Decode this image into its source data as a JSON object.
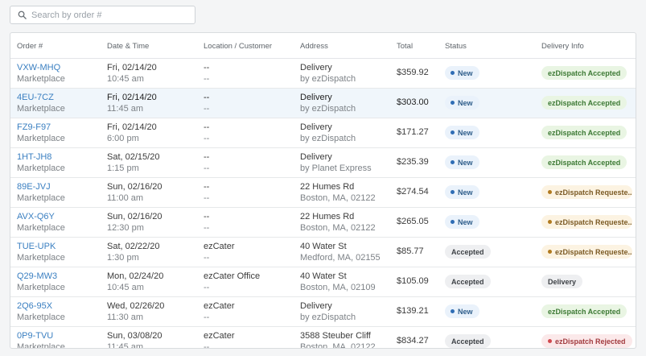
{
  "search": {
    "placeholder": "Search by order #"
  },
  "headers": [
    "Order #",
    "Date & Time",
    "Location / Customer",
    "Address",
    "Total",
    "Status",
    "Delivery Info"
  ],
  "colors": {
    "link": "#3a7fc1",
    "new_dot": "#2f6db5",
    "requested_dot": "#b17a1f",
    "rejected_dot": "#d14a4f"
  },
  "orders": [
    {
      "id": "VXW-MHQ",
      "source": "Marketplace",
      "date": "Fri, 02/14/20",
      "time": "10:45 am",
      "location": "--",
      "customer": "--",
      "addr1": "Delivery",
      "addr2": "by ezDispatch",
      "total": "$359.92",
      "status": "New",
      "delivery": "ezDispatch Accepted"
    },
    {
      "id": "4EU-7CZ",
      "source": "Marketplace",
      "date": "Fri, 02/14/20",
      "time": "11:45 am",
      "location": "--",
      "customer": "--",
      "addr1": "Delivery",
      "addr2": "by ezDispatch",
      "total": "$303.00",
      "status": "New",
      "delivery": "ezDispatch Accepted"
    },
    {
      "id": "FZ9-F97",
      "source": "Marketplace",
      "date": "Fri, 02/14/20",
      "time": "6:00 pm",
      "location": "--",
      "customer": "--",
      "addr1": "Delivery",
      "addr2": "by ezDispatch",
      "total": "$171.27",
      "status": "New",
      "delivery": "ezDispatch Accepted"
    },
    {
      "id": "1HT-JH8",
      "source": "Marketplace",
      "date": "Sat, 02/15/20",
      "time": "1:15 pm",
      "location": "--",
      "customer": "--",
      "addr1": "Delivery",
      "addr2": "by Planet Express",
      "total": "$235.39",
      "status": "New",
      "delivery": "ezDispatch Accepted"
    },
    {
      "id": "89E-JVJ",
      "source": "Marketplace",
      "date": "Sun, 02/16/20",
      "time": "11:00 am",
      "location": "--",
      "customer": "--",
      "addr1": "22 Humes Rd",
      "addr2": "Boston, MA, 02122",
      "total": "$274.54",
      "status": "New",
      "delivery": "ezDispatch Requeste..."
    },
    {
      "id": "AVX-Q6Y",
      "source": "Marketplace",
      "date": "Sun, 02/16/20",
      "time": "12:30 pm",
      "location": "--",
      "customer": "--",
      "addr1": "22 Humes Rd",
      "addr2": "Boston, MA, 02122",
      "total": "$265.05",
      "status": "New",
      "delivery": "ezDispatch Requeste..."
    },
    {
      "id": "TUE-UPK",
      "source": "Marketplace",
      "date": "Sat, 02/22/20",
      "time": "1:30 pm",
      "location": "ezCater",
      "customer": "--",
      "addr1": "40 Water St",
      "addr2": "Medford, MA, 02155",
      "total": "$85.77",
      "status": "Accepted",
      "delivery": "ezDispatch Requeste..."
    },
    {
      "id": "Q29-MW3",
      "source": "Marketplace",
      "date": "Mon, 02/24/20",
      "time": "10:45 am",
      "location": "ezCater Office",
      "customer": "--",
      "addr1": "40 Water St",
      "addr2": "Boston, MA, 02109",
      "total": "$105.09",
      "status": "Accepted",
      "delivery": "Delivery"
    },
    {
      "id": "2Q6-95X",
      "source": "Marketplace",
      "date": "Wed, 02/26/20",
      "time": "11:30 am",
      "location": "ezCater",
      "customer": "--",
      "addr1": "Delivery",
      "addr2": "by ezDispatch",
      "total": "$139.21",
      "status": "New",
      "delivery": "ezDispatch Accepted"
    },
    {
      "id": "0P9-TVU",
      "source": "Marketplace",
      "date": "Sun, 03/08/20",
      "time": "11:45 am",
      "location": "ezCater",
      "customer": "--",
      "addr1": "3588 Steuber Cliff",
      "addr2": "Boston, MA, 02122",
      "total": "$834.27",
      "status": "Accepted",
      "delivery": "ezDispatch Rejected"
    }
  ]
}
